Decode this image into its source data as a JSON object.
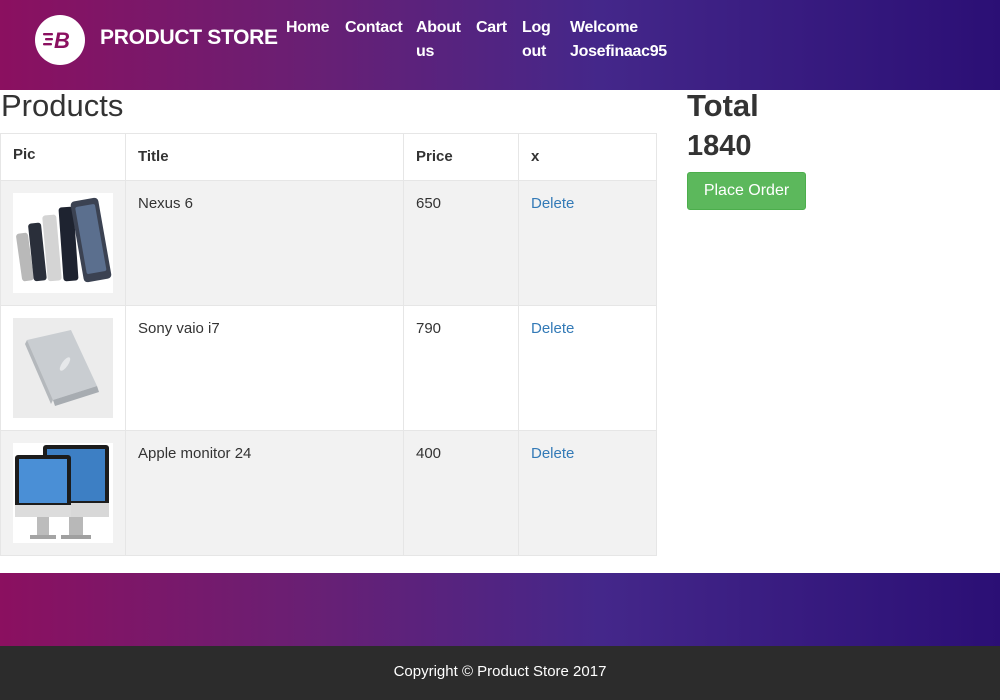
{
  "header": {
    "brand": "PRODUCT STORE",
    "logo_icon": "store-logo-icon",
    "nav": {
      "home": "Home",
      "contact": "Contact",
      "about_line1": "About",
      "about_line2": "us",
      "cart": "Cart",
      "logout_line1": "Log",
      "logout_line2": "out",
      "welcome_line1": "Welcome",
      "welcome_line2": "Josefinaac95"
    }
  },
  "products": {
    "title": "Products",
    "columns": {
      "pic": "Pic",
      "title": "Title",
      "price": "Price",
      "x": "x"
    },
    "rows": [
      {
        "image": "nexus-phones-image",
        "title": "Nexus 6",
        "price": "650",
        "action": "Delete"
      },
      {
        "image": "sony-laptop-image",
        "title": "Sony vaio i7",
        "price": "790",
        "action": "Delete"
      },
      {
        "image": "apple-monitor-image",
        "title": "Apple monitor 24",
        "price": "400",
        "action": "Delete"
      }
    ]
  },
  "summary": {
    "total_label": "Total",
    "total_value": "1840",
    "place_order": "Place Order"
  },
  "footer": {
    "copyright": "Copyright © Product Store 2017"
  },
  "colors": {
    "header_gradient_start": "#8b1060",
    "header_gradient_end": "#2b0f75",
    "place_order_button": "#5cb85c",
    "link": "#337ab7",
    "footer_dark": "#2c2c2c"
  }
}
